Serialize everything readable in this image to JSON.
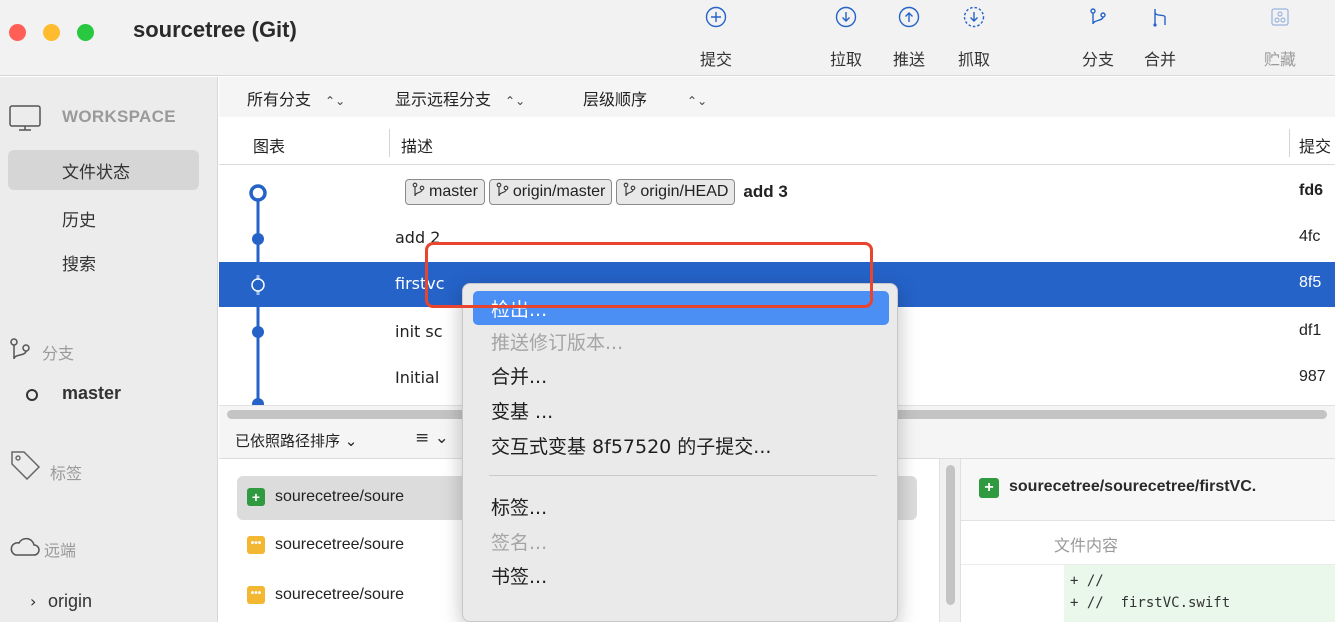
{
  "window": {
    "title": "sourcetree (Git)"
  },
  "toolbar": {
    "buttons": [
      {
        "label": "提交",
        "icon": "commit-icon"
      },
      {
        "label": "拉取",
        "icon": "pull-icon"
      },
      {
        "label": "推送",
        "icon": "push-icon"
      },
      {
        "label": "抓取",
        "icon": "fetch-icon"
      },
      {
        "label": "分支",
        "icon": "branch-icon"
      },
      {
        "label": "合并",
        "icon": "merge-icon"
      },
      {
        "label": "贮藏",
        "icon": "stash-icon",
        "disabled": true
      }
    ]
  },
  "sidebar": {
    "workspace_label": "WORKSPACE",
    "workspace_items": [
      "文件状态",
      "历史",
      "搜索"
    ],
    "selected_item": "文件状态",
    "branches_label": "分支",
    "current_branch": "master",
    "tags_label": "标签",
    "remotes_label": "远端",
    "remote_origin": "origin"
  },
  "filters": {
    "branches": "所有分支",
    "remote_branches": "显示远程分支",
    "order": "层级顺序"
  },
  "commit_table": {
    "columns": {
      "graph": "图表",
      "description": "描述",
      "commit": "提交"
    },
    "rows": [
      {
        "refs": [
          "master",
          "origin/master",
          "origin/HEAD"
        ],
        "message": "add 3",
        "hash": "fd6",
        "bold": true
      },
      {
        "message": "add 2",
        "hash": "4fc"
      },
      {
        "message": "firstvc",
        "hash": "8f5",
        "selected": true
      },
      {
        "message": "init sc",
        "hash": "df1"
      },
      {
        "message": "Initial",
        "hash": "987"
      }
    ]
  },
  "lower_panel": {
    "sort_label": "已依照路径排序 ⌄",
    "list_mode": "≡ ⌄",
    "files": [
      {
        "status": "added",
        "name": "sourecetree/soure",
        "selected": true
      },
      {
        "status": "modified",
        "name": "sourecetree/soure"
      },
      {
        "status": "modified",
        "name": "sourecetree/soure"
      }
    ]
  },
  "diff": {
    "file_title": "sourecetree/sourecetree/firstVC.",
    "content_label": "文件内容",
    "lines": [
      "+ //",
      "+ //  firstVC.swift"
    ]
  },
  "context_menu": {
    "items": [
      {
        "label": "检出...",
        "highlighted": true
      },
      {
        "label": "推送修订版本...",
        "disabled": true
      },
      {
        "label": "合并..."
      },
      {
        "label": "变基 ..."
      },
      {
        "label": "交互式变基 8f57520 的子提交..."
      },
      {
        "separator": true
      },
      {
        "label": "标签..."
      },
      {
        "label": "签名...",
        "disabled": true
      },
      {
        "label": "书签..."
      }
    ]
  },
  "colors": {
    "selection_blue": "#2563c9",
    "menu_highlight": "#4b8ff5",
    "annotation_red": "#e8442e",
    "graph_line": "#2563c9"
  }
}
